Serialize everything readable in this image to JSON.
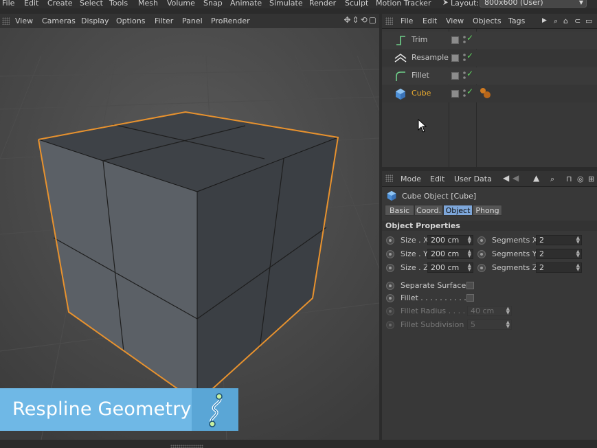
{
  "main_menu": [
    "File",
    "Edit",
    "Create",
    "Select",
    "Tools",
    "Mesh",
    "Volume",
    "Snap",
    "Animate",
    "Simulate",
    "Render",
    "Sculpt",
    "Motion Tracker"
  ],
  "layout": {
    "label": "Layout:",
    "value": "800x600 (User)"
  },
  "viewport": {
    "menu": [
      "View",
      "Cameras",
      "Display",
      "Options",
      "Filter",
      "Panel",
      "ProRender"
    ],
    "nav_icons": [
      "move-icon",
      "zoom-icon",
      "rotate-icon",
      "maximize-icon"
    ],
    "selection_color": "#e8922e"
  },
  "banner": {
    "text": "Respline Geometry",
    "bg_color": "#6fb8e6"
  },
  "object_manager": {
    "menu": [
      "File",
      "Edit",
      "View",
      "Objects",
      "Tags"
    ],
    "objects": [
      {
        "name": "Trim",
        "icon": "trim-icon",
        "active": false
      },
      {
        "name": "Resample",
        "icon": "resample-icon",
        "active": false
      },
      {
        "name": "Fillet",
        "icon": "fillet-icon",
        "active": false
      },
      {
        "name": "Cube",
        "icon": "cube-icon",
        "active": true
      }
    ]
  },
  "attribute_manager": {
    "menu": [
      "Mode",
      "Edit",
      "User Data"
    ],
    "title": "Cube Object [Cube]",
    "tabs": [
      {
        "label": "Basic",
        "active": false
      },
      {
        "label": "Coord.",
        "active": false
      },
      {
        "label": "Object",
        "active": true
      },
      {
        "label": "Phong",
        "active": false
      }
    ],
    "section": "Object Properties",
    "size": [
      {
        "label": "Size . X",
        "value": "200 cm"
      },
      {
        "label": "Size . Y",
        "value": "200 cm"
      },
      {
        "label": "Size . Z",
        "value": "200 cm"
      }
    ],
    "segments": [
      {
        "label": "Segments X",
        "value": "2"
      },
      {
        "label": "Segments Y",
        "value": "2"
      },
      {
        "label": "Segments Z",
        "value": "2"
      }
    ],
    "separate_surfaces": {
      "label": "Separate Surfaces",
      "checked": false
    },
    "fillet": {
      "label": "Fillet . . . . . . . . . . .",
      "checked": false
    },
    "fillet_radius": {
      "label": "Fillet Radius . . . . .",
      "value": "40 cm"
    },
    "fillet_subdivision": {
      "label": "Fillet Subdivision",
      "value": "5"
    }
  }
}
